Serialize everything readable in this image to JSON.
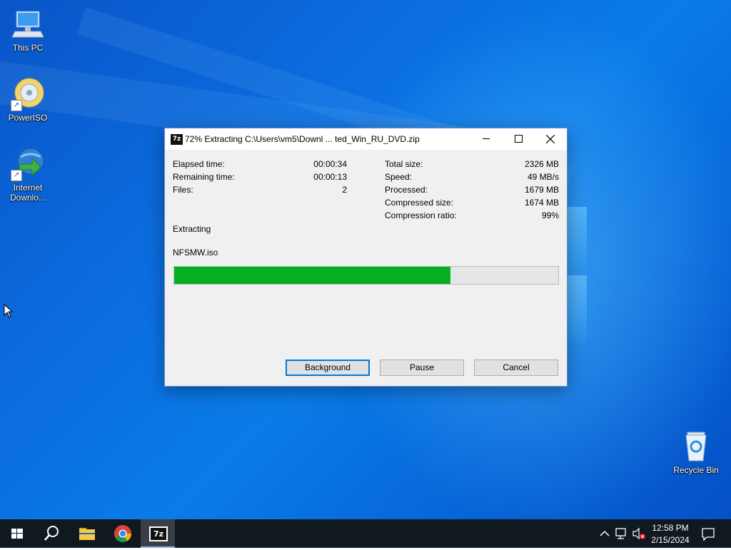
{
  "desktop": {
    "icons": [
      {
        "label": "This PC",
        "icon": "computer-icon"
      },
      {
        "label": "PowerISO",
        "icon": "poweriso-icon"
      },
      {
        "label": "Internet\nDownlo...",
        "icon": "internet-download-manager-icon"
      },
      {
        "label": "Recycle Bin",
        "icon": "recycle-bin-icon"
      }
    ]
  },
  "window": {
    "app_icon_text": "7z",
    "title": "72% Extracting C:\\Users\\vm5\\Downl ... ted_Win_RU_DVD.zip",
    "left_stats": [
      {
        "label": "Elapsed time:",
        "value": "00:00:34"
      },
      {
        "label": "Remaining time:",
        "value": "00:00:13"
      },
      {
        "label": "Files:",
        "value": "2"
      }
    ],
    "right_stats": [
      {
        "label": "Total size:",
        "value": "2326 MB"
      },
      {
        "label": "Speed:",
        "value": "49 MB/s"
      },
      {
        "label": "Processed:",
        "value": "1679 MB"
      },
      {
        "label": "Compressed size:",
        "value": "1674 MB"
      },
      {
        "label": "Compression ratio:",
        "value": "99%"
      }
    ],
    "status": "Extracting",
    "current_file": "NFSMW.iso",
    "progress_percent": 72,
    "buttons": {
      "background": "Background",
      "pause": "Pause",
      "cancel": "Cancel"
    }
  },
  "taskbar": {
    "pinned": [
      "windows-start-icon",
      "search-icon",
      "file-explorer-icon",
      "chrome-icon",
      "7zip-icon"
    ],
    "active_app": "7z",
    "clock": {
      "time": "12:58 PM",
      "date": "2/15/2024"
    }
  },
  "colors": {
    "progress_fill": "#06b025",
    "accent": "#0078d7",
    "taskbar": "#101820"
  }
}
